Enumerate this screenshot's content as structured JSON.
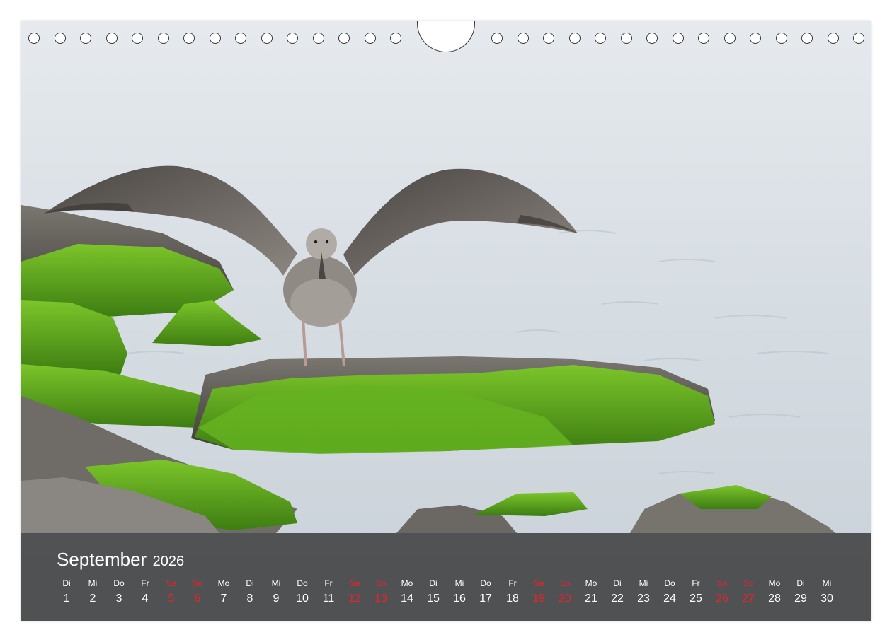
{
  "calendar": {
    "month": "September",
    "year": "2026",
    "weekdays": [
      "Di",
      "Mi",
      "Do",
      "Fr",
      "Sa",
      "So",
      "Mo",
      "Di",
      "Mi",
      "Do",
      "Fr",
      "Sa",
      "So",
      "Mo",
      "Di",
      "Mi",
      "Do",
      "Fr",
      "Sa",
      "So",
      "Mo",
      "Di",
      "Mi",
      "Do",
      "Fr",
      "Sa",
      "So",
      "Mo",
      "Di",
      "Mi"
    ],
    "days": [
      "1",
      "2",
      "3",
      "4",
      "5",
      "6",
      "7",
      "8",
      "9",
      "10",
      "11",
      "12",
      "13",
      "14",
      "15",
      "16",
      "17",
      "18",
      "19",
      "20",
      "21",
      "22",
      "23",
      "24",
      "25",
      "26",
      "27",
      "28",
      "29",
      "30"
    ],
    "weekend_color": "#e8232c"
  },
  "photo": {
    "subject": "seagull",
    "water_color": "#dde3e8",
    "moss_color": "#5fae1f"
  }
}
